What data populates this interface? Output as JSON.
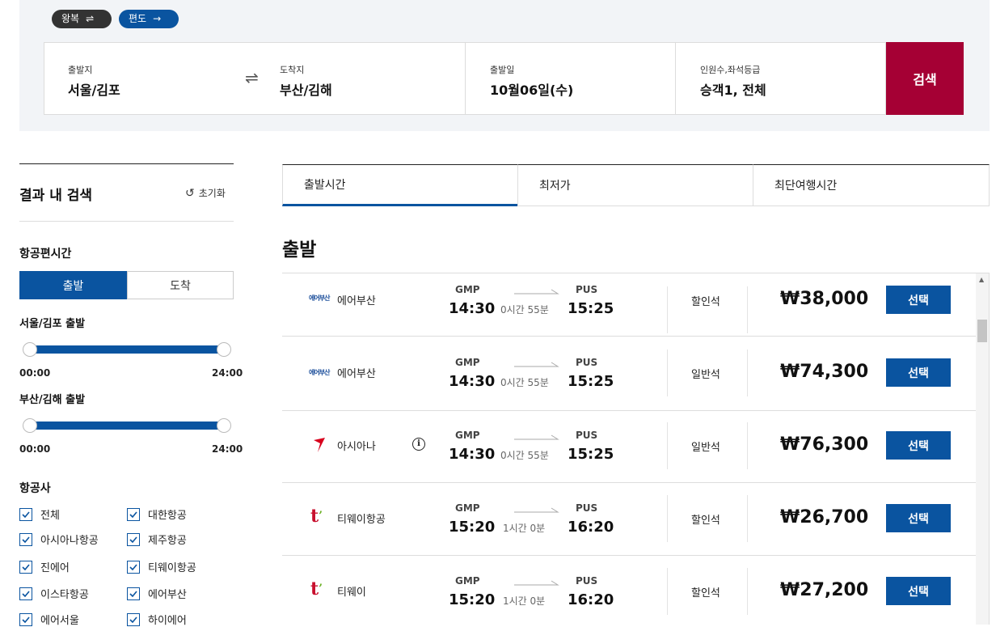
{
  "trip_type": {
    "round": "왕복",
    "oneway": "편도"
  },
  "search": {
    "origin_label": "출발지",
    "origin_value": "서울/김포",
    "dest_label": "도착지",
    "dest_value": "부산/김해",
    "date_label": "출발일",
    "date_value": "10월06일(수)",
    "pax_label": "인원수,좌석등급",
    "pax_value": "승객1, 전체",
    "search_button": "검색"
  },
  "filter": {
    "title": "결과 내 검색",
    "reset": "초기화",
    "time_section": "항공편시간",
    "depart_tab": "출발",
    "arrive_tab": "도착",
    "slider1_label": "서울/김포 출발",
    "slider2_label": "부산/김해 출발",
    "range_min": "00:00",
    "range_max": "24:00",
    "airline_section": "항공사",
    "airlines": [
      "전체",
      "대한항공",
      "아시아나항공",
      "제주항공",
      "진에어",
      "티웨이항공",
      "이스타항공",
      "에어부산",
      "에어서울",
      "하이에어"
    ]
  },
  "sort_tabs": [
    "출발시간",
    "최저가",
    "최단여행시간"
  ],
  "results_title": "출발",
  "flights": [
    {
      "airline": "에어부산",
      "logo": "에어부산",
      "from": "GMP",
      "dep": "14:30",
      "dur": "0시간 55분",
      "to": "PUS",
      "arr": "15:25",
      "seat": "할인석",
      "price": "₩38,000",
      "btn": "선택"
    },
    {
      "airline": "에어부산",
      "logo": "에어부산",
      "from": "GMP",
      "dep": "14:30",
      "dur": "0시간 55분",
      "to": "PUS",
      "arr": "15:25",
      "seat": "일반석",
      "price": "₩74,300",
      "btn": "선택"
    },
    {
      "airline": "아시아나",
      "from": "GMP",
      "dep": "14:30",
      "dur": "0시간 55분",
      "to": "PUS",
      "arr": "15:25",
      "seat": "일반석",
      "price": "₩76,300",
      "btn": "선택"
    },
    {
      "airline": "티웨이항공",
      "from": "GMP",
      "dep": "15:20",
      "dur": "1시간 0분",
      "to": "PUS",
      "arr": "16:20",
      "seat": "할인석",
      "price": "₩26,700",
      "btn": "선택"
    },
    {
      "airline": "티웨이",
      "from": "GMP",
      "dep": "15:20",
      "dur": "1시간 0분",
      "to": "PUS",
      "arr": "16:20",
      "seat": "할인석",
      "price": "₩27,200",
      "btn": "선택"
    }
  ],
  "colors": {
    "primary": "#0a54a0",
    "search_button": "#a50034",
    "asiana": "#d8001c",
    "tway": "#c8102e"
  }
}
